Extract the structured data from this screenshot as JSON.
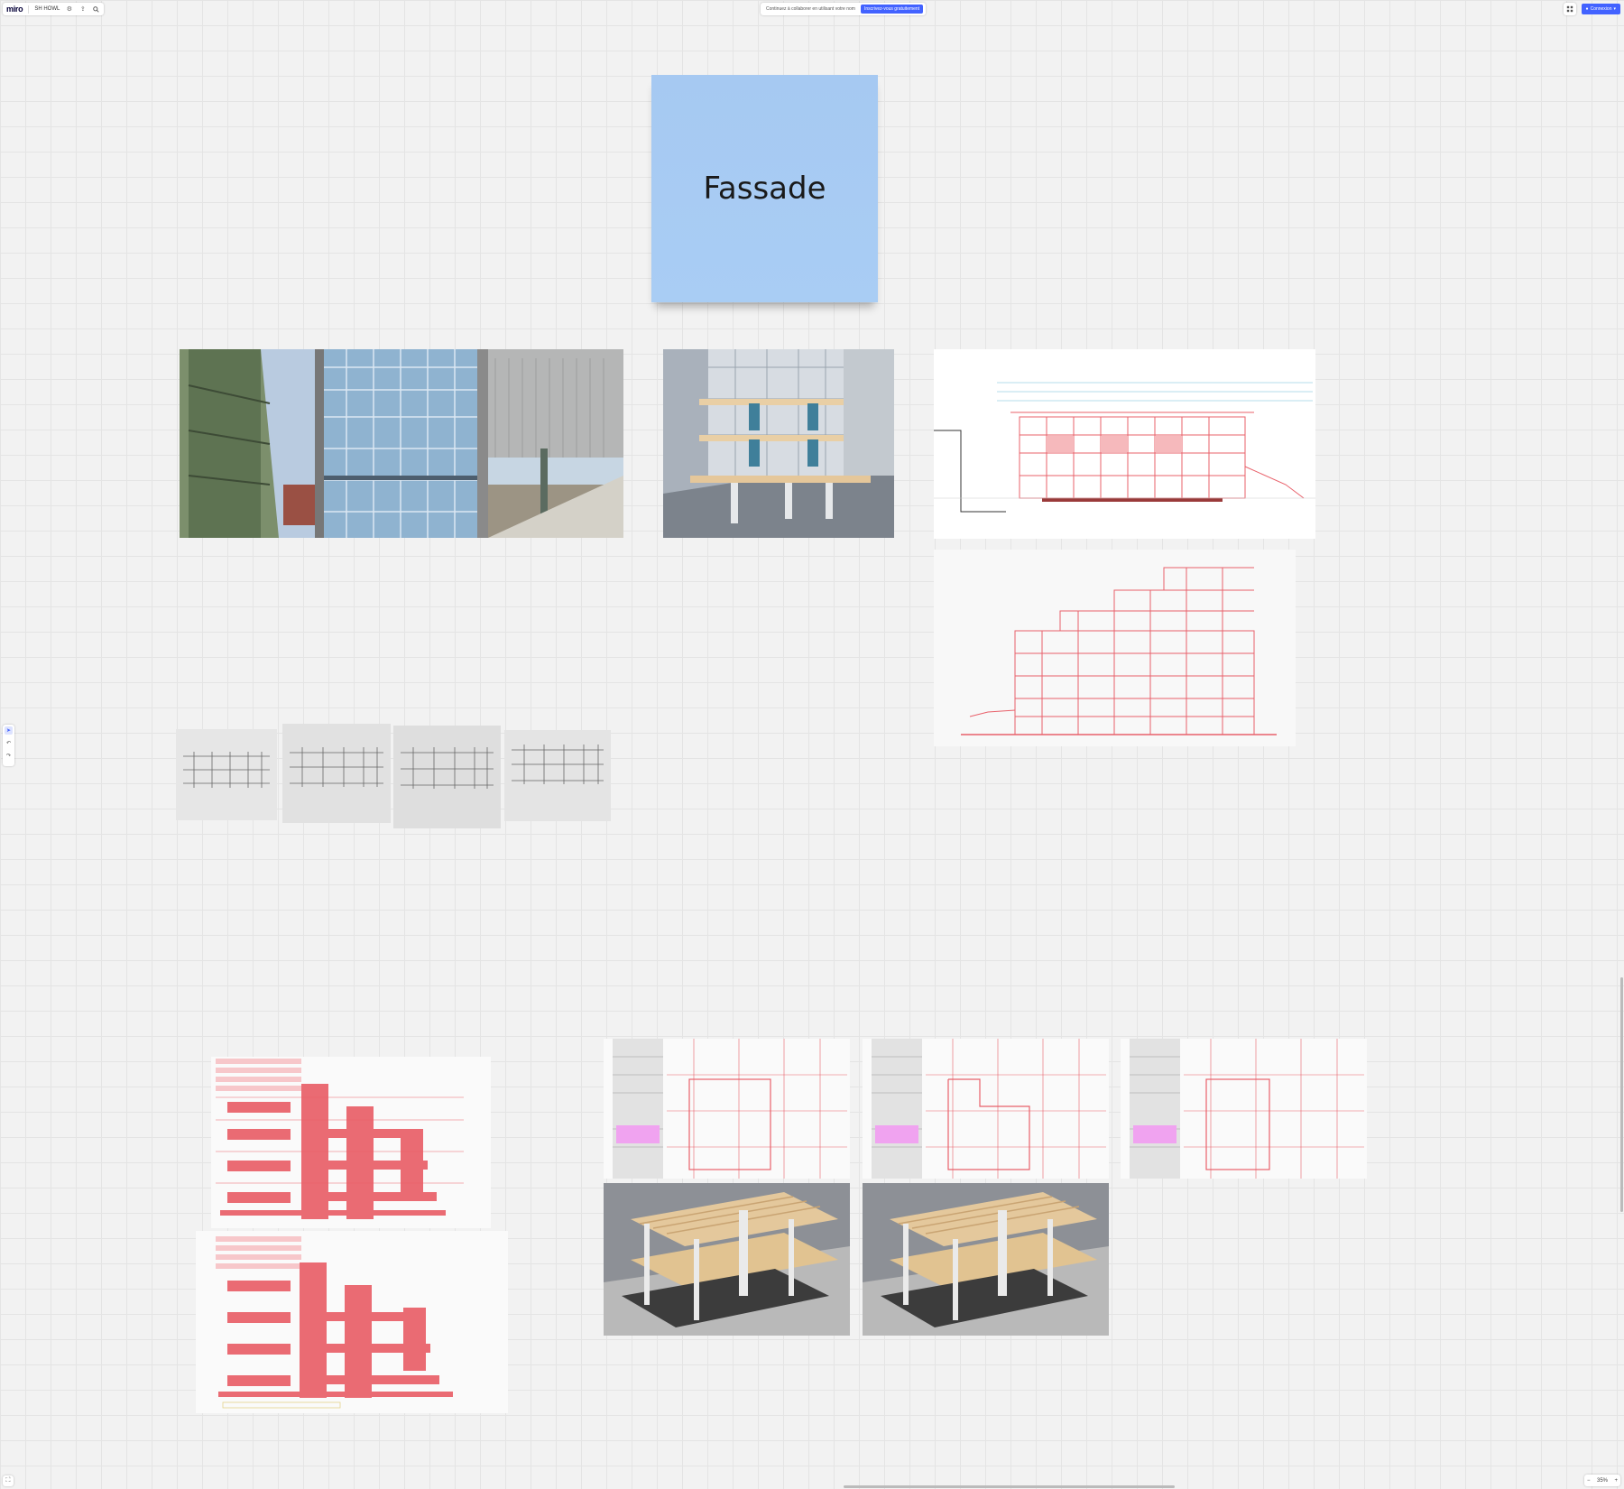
{
  "app": {
    "logo": "miro",
    "board_name": "SH HOWL"
  },
  "banner": {
    "text": "Continuez à collaborer en utilisant votre nom",
    "signup_label": "Inscrivez-vous gratuitement"
  },
  "toolbar_right": {
    "connect_label": "Connexion"
  },
  "sticky_note": {
    "text": "Fassade",
    "color": "#a6c9f2"
  },
  "zoom": {
    "value": "35%"
  },
  "icons": {
    "settings": "gear-icon",
    "export": "upload-icon",
    "search": "search-icon",
    "apps": "apps-icon",
    "select": "cursor-icon",
    "undo": "undo-icon",
    "redo": "redo-icon",
    "minimap": "minimap-icon",
    "zoom_out": "minus-icon",
    "zoom_in": "plus-icon"
  },
  "colors": {
    "accent": "#4262ff",
    "canvas": "#f2f2f2",
    "drawing_red": "#e8606a"
  }
}
